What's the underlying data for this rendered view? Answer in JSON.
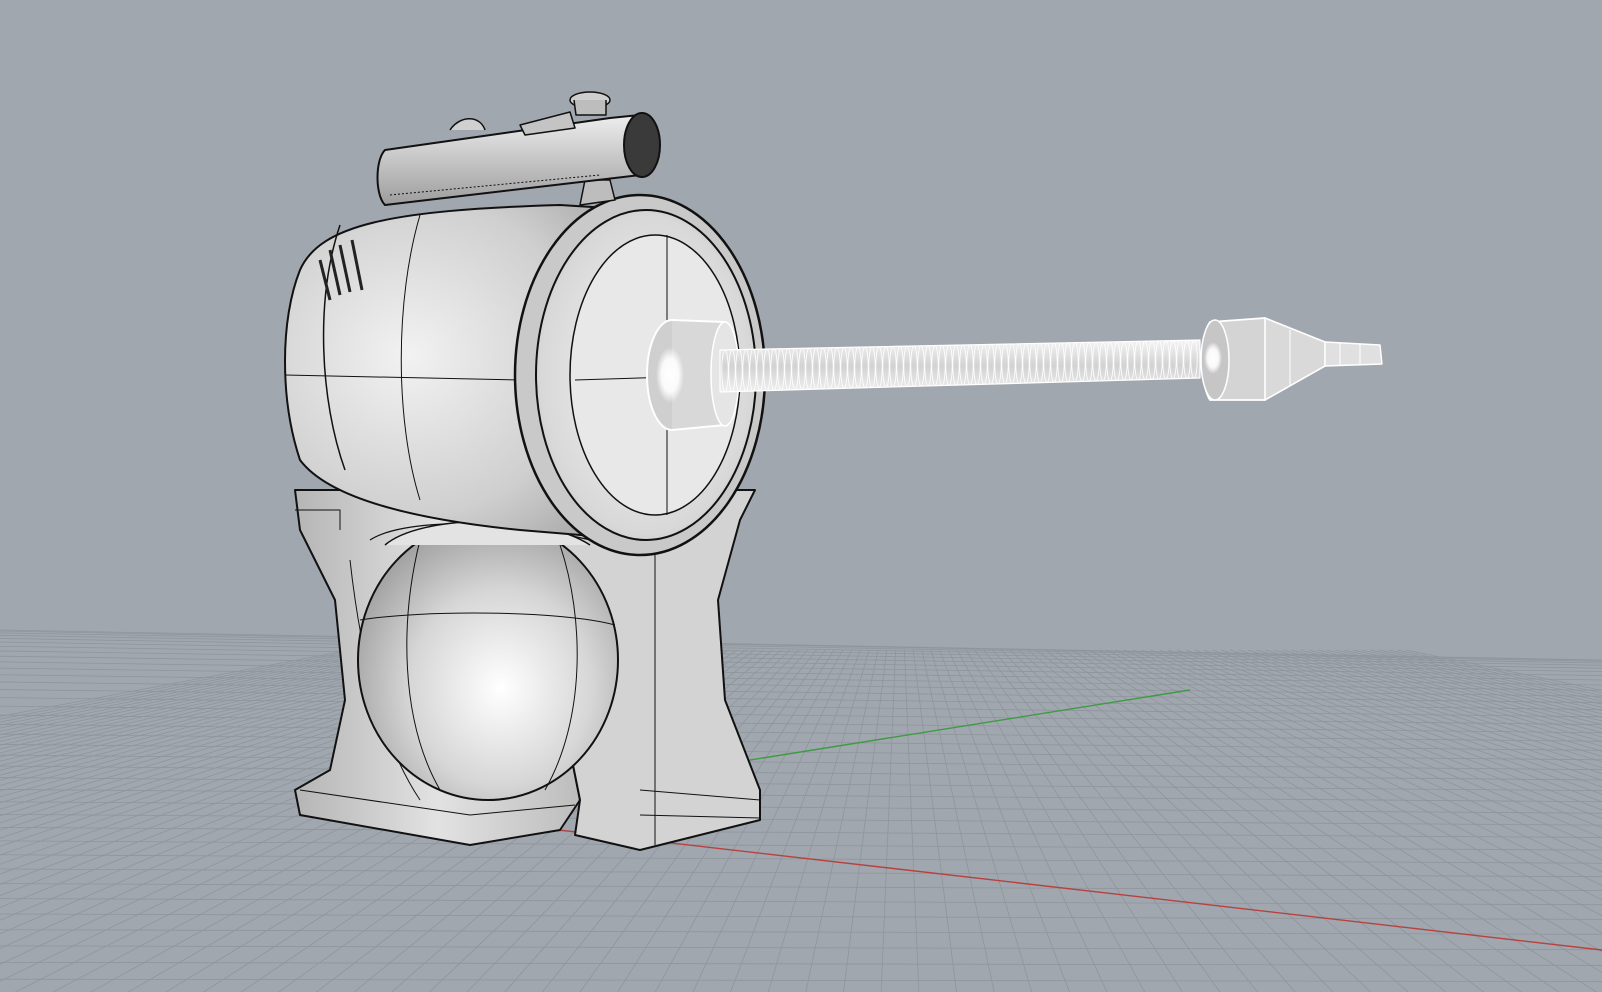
{
  "viewport": {
    "view_mode": "perspective",
    "display_mode": "shaded-with-edges",
    "background_color": "#a1a7ae",
    "grid_color": "#8f959c",
    "x_axis_color": "#b8413f",
    "y_axis_color": "#3f9a45",
    "model_color": "#cfcfcf",
    "edge_color": "#111111",
    "selected_color": "#ffffff"
  },
  "model": {
    "parts": [
      "base-stand",
      "spherical-tank",
      "cylinder-body",
      "front-cap",
      "top-scope",
      "top-knob",
      "nozzle-hub",
      "flexible-hose",
      "nozzle-collar",
      "nozzle-cone",
      "nozzle-tip"
    ],
    "selected_parts": [
      "nozzle-hub",
      "flexible-hose",
      "nozzle-collar",
      "nozzle-cone",
      "nozzle-tip"
    ]
  }
}
